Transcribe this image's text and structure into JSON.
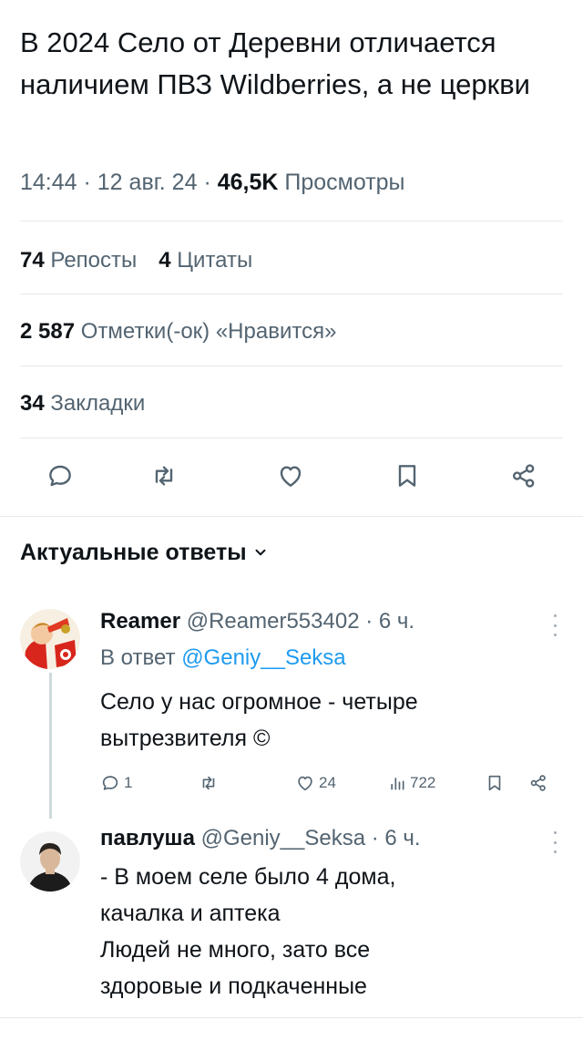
{
  "tweet": {
    "text": "В 2024 Село от Деревни отличается наличием ПВЗ Wildberries, а не церкви",
    "time": "14:44",
    "sep1": " · ",
    "date": "12 авг. 24",
    "sep2": " · ",
    "views_count": "46,5K",
    "views_label": " Просмотры"
  },
  "stats": {
    "reposts_count": "74",
    "reposts_label": " Репосты",
    "quotes_count": "4",
    "quotes_label": " Цитаты",
    "likes_count": "2 587",
    "likes_label": " Отметки(-ок) «Нравится»",
    "bookmarks_count": "34",
    "bookmarks_label": " Закладки"
  },
  "actions": {
    "icons": [
      "reply-icon",
      "retweet-icon",
      "like-icon",
      "bookmark-icon",
      "share-icon"
    ]
  },
  "section": {
    "title": "Актуальные ответы"
  },
  "replies": [
    {
      "name": "Reamer",
      "handle": "@Reamer553402",
      "time_sep": " · ",
      "time": "6 ч.",
      "reply_to_label": "В ответ ",
      "reply_to_handle": "@Geniy__Seksa",
      "text": "Село у нас огромное - четыре вытрезвителя ©",
      "reply_count": "1",
      "retweet_count": "",
      "like_count": "24",
      "view_count": "722"
    },
    {
      "name": "павлуша",
      "handle": "@Geniy__Seksa",
      "time_sep": " · ",
      "time": "6 ч.",
      "text_lines": [
        "- В моем селе было 4 дома,",
        "качалка и аптека",
        "Людей не много, зато все",
        "здоровые и подкаченные"
      ]
    }
  ],
  "colors": {
    "text": "#0f1419",
    "secondary": "#536471",
    "link": "#1d9bf0",
    "divider": "#e6e9ec"
  }
}
